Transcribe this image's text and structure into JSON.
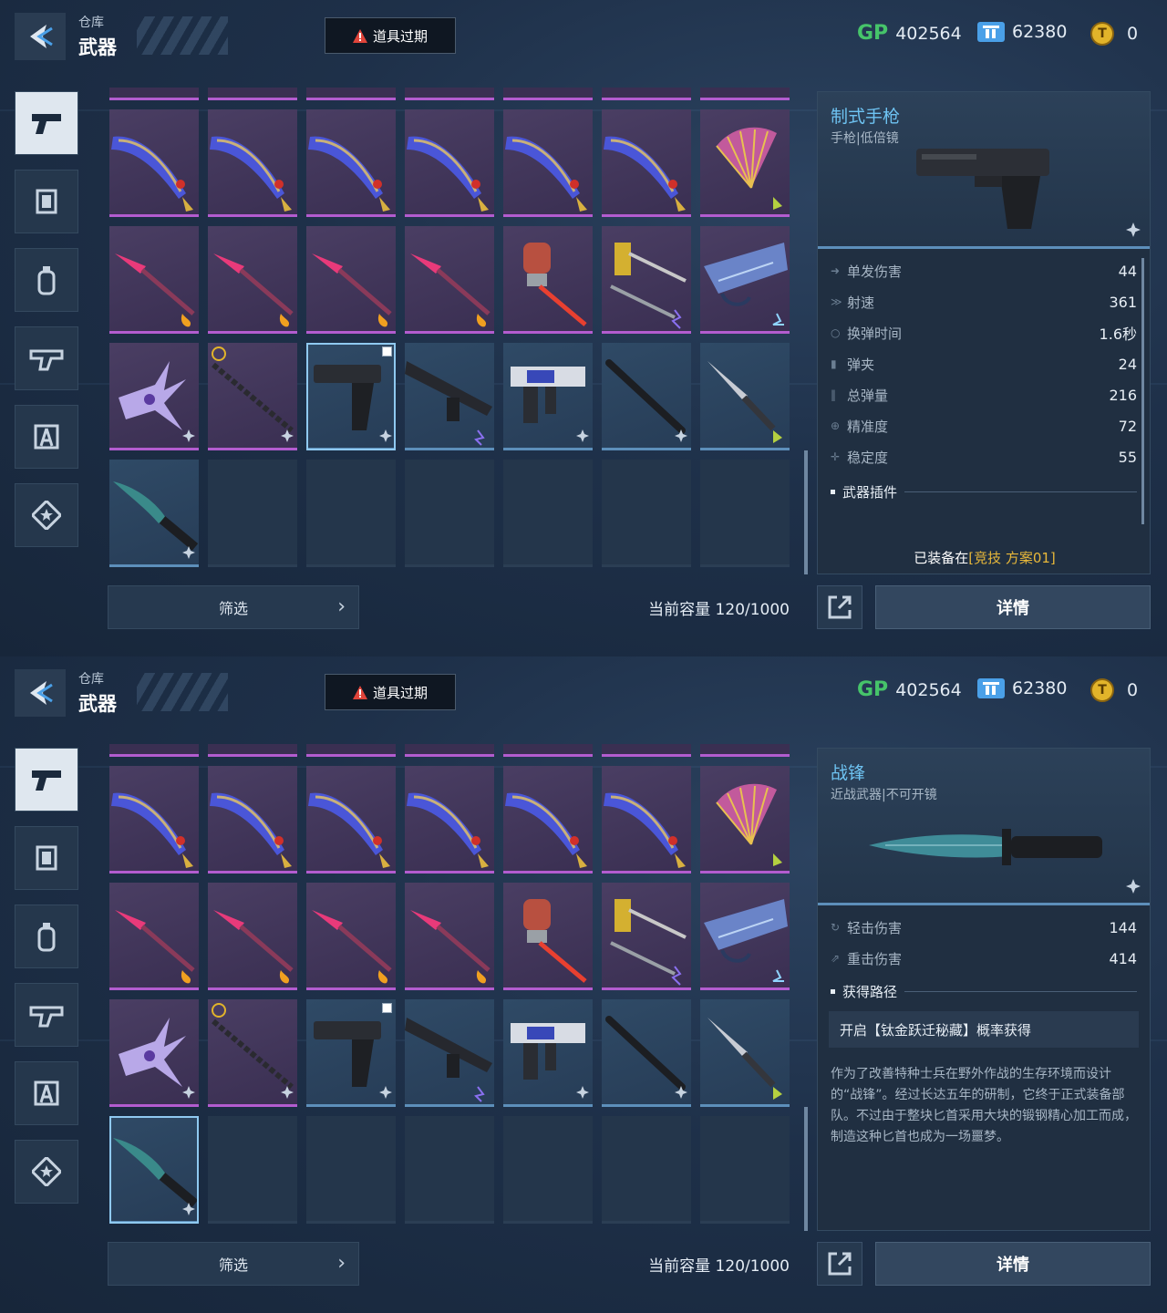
{
  "screens": [
    {
      "header": {
        "breadcrumb": "仓库",
        "title": "武器",
        "expired_label": "道具过期"
      },
      "currencies": {
        "gp_label": "GP",
        "gp_value": "402564",
        "ticket_value": "62380",
        "coin_value": "0"
      },
      "bottom": {
        "filter_label": "筛选",
        "capacity": "当前容量 120/1000",
        "detail_label": "详情"
      },
      "weapon": {
        "name": "制式手枪",
        "subtitle": "手枪|低倍镜",
        "stats": [
          {
            "label": "单发伤害",
            "value": "44"
          },
          {
            "label": "射速",
            "value": "361"
          },
          {
            "label": "换弹时间",
            "value": "1.6秒"
          },
          {
            "label": "弹夹",
            "value": "24"
          },
          {
            "label": "总弹量",
            "value": "216"
          },
          {
            "label": "精准度",
            "value": "72"
          },
          {
            "label": "稳定度",
            "value": "55"
          }
        ],
        "section_title": "武器插件",
        "equipped_prefix": "已装备在",
        "equipped_highlight": "[竞技 方案01]"
      }
    },
    {
      "header": {
        "breadcrumb": "仓库",
        "title": "武器",
        "expired_label": "道具过期"
      },
      "currencies": {
        "gp_label": "GP",
        "gp_value": "402564",
        "ticket_value": "62380",
        "coin_value": "0"
      },
      "bottom": {
        "filter_label": "筛选",
        "capacity": "当前容量 120/1000",
        "detail_label": "详情"
      },
      "weapon": {
        "name": "战锋",
        "subtitle": "近战武器|不可开镜",
        "stats": [
          {
            "label": "轻击伤害",
            "value": "144"
          },
          {
            "label": "重击伤害",
            "value": "414"
          }
        ],
        "section_title": "获得路径",
        "source": "开启【钛金跃迁秘藏】概率获得",
        "description": "作为了改善特种士兵在野外作战的生存环境而设计的“战锋”。经过长达五年的研制，它终于正式装备部队。不过由于整块匕首采用大块的锻钢精心加工而成，制造这种匕首也成为一场噩梦。"
      }
    }
  ],
  "colors": {
    "rarity_purple": "#b35ccf",
    "rarity_blue": "#5d8fba",
    "accent_name": "#6ec3f2",
    "highlight": "#e8b83a"
  },
  "icons": {
    "categories": [
      "pistol-icon",
      "armor-icon",
      "grenade-icon",
      "rifle-icon",
      "tool-icon",
      "star-badge-icon"
    ],
    "grid_rows": [
      [
        "ornate-dagger",
        "ornate-dagger",
        "ornate-dagger",
        "ornate-dagger",
        "ornate-dagger",
        "ornate-dagger",
        "war-fan"
      ],
      [
        "crimson-spear",
        "crimson-spear",
        "crimson-spear",
        "crimson-spear",
        "fire-axe",
        "gold-launcher",
        "blue-crossbow"
      ],
      [
        "winged-blade",
        "chain-staff",
        "standard-pistol",
        "smg",
        "blue-rifle",
        "baton",
        "combat-knife"
      ],
      [
        "battle-knife",
        "empty",
        "empty",
        "empty",
        "empty",
        "empty",
        "empty"
      ]
    ]
  }
}
